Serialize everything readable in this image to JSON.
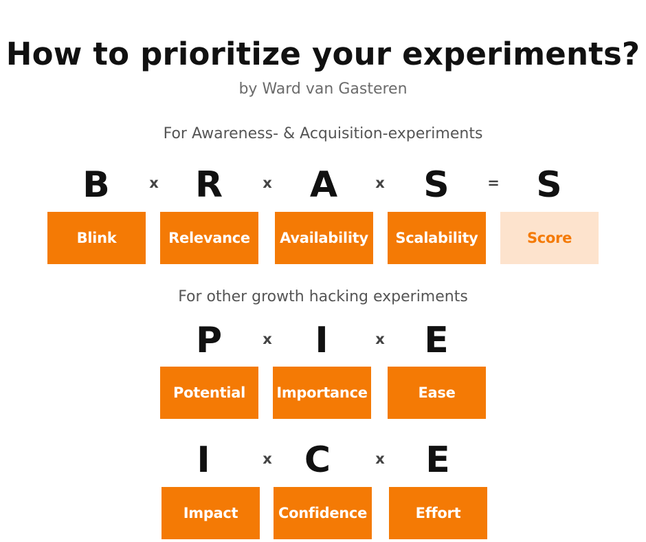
{
  "title": "How to prioritize your experiments?",
  "author": "by Ward van Gasteren",
  "colors": {
    "accent": "#f47a05",
    "score_bg": "#fde3cd",
    "text": "#111111"
  },
  "brass": {
    "label": "For Awareness- & Acquisition-experiments",
    "letters": [
      "B",
      "R",
      "A",
      "S",
      "S"
    ],
    "operators": [
      "x",
      "x",
      "x",
      "="
    ],
    "boxes": [
      "Blink",
      "Relevance",
      "Availability",
      "Scalability",
      "Score"
    ]
  },
  "other": {
    "label": "For other growth hacking experiments"
  },
  "pie": {
    "letters": [
      "P",
      "I",
      "E"
    ],
    "operators": [
      "x",
      "x"
    ],
    "boxes": [
      "Potential",
      "Importance",
      "Ease"
    ]
  },
  "ice": {
    "letters": [
      "I",
      "C",
      "E"
    ],
    "operators": [
      "x",
      "x"
    ],
    "boxes": [
      "Impact",
      "Confidence",
      "Effort"
    ]
  }
}
